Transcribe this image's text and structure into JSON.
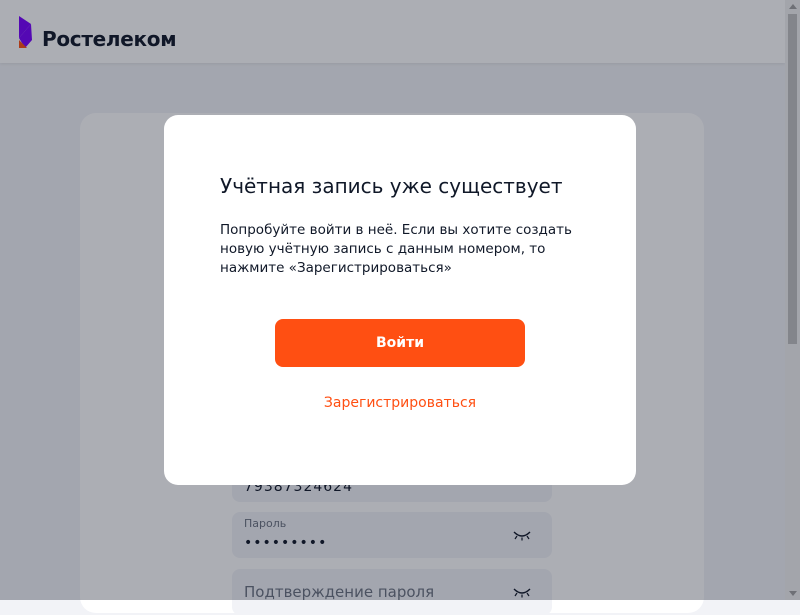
{
  "header": {
    "brand_name": "Ростелеком",
    "logo_colors": {
      "purple": "#7800ff",
      "orange": "#ff4f12"
    }
  },
  "form": {
    "phone_value": "79387324624",
    "password_label": "Пароль",
    "password_value": "•••••••••",
    "confirm_placeholder": "Подтверждение пароля"
  },
  "modal": {
    "title": "Учётная запись уже существует",
    "text": "Попробуйте войти в неё. Если вы хотите создать новую учётную запись с данным номером, то нажмите «Зарегистрироваться»",
    "login_button": "Войти",
    "register_link": "Зарегистрироваться"
  },
  "colors": {
    "accent": "#ff4f12",
    "text": "#101828",
    "page_bg": "#f2f3f7"
  }
}
